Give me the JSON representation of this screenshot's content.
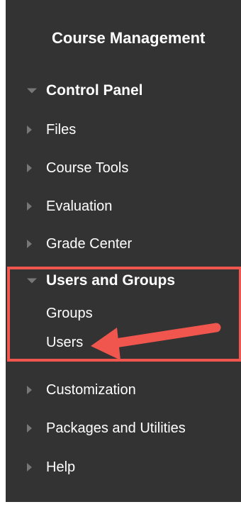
{
  "panel": {
    "title": "Course Management",
    "control_panel": "Control Panel",
    "items": [
      {
        "label": "Files"
      },
      {
        "label": "Course Tools"
      },
      {
        "label": "Evaluation"
      },
      {
        "label": "Grade Center"
      }
    ],
    "users_and_groups": {
      "label": "Users and Groups",
      "children": [
        {
          "label": "Groups"
        },
        {
          "label": "Users"
        }
      ]
    },
    "bottom_items": [
      {
        "label": "Customization"
      },
      {
        "label": "Packages and Utilities"
      },
      {
        "label": "Help"
      }
    ]
  },
  "colors": {
    "panel_bg": "#333333",
    "highlight": "#f0554e",
    "arrow": "#f0554e",
    "triangle": "#777777"
  }
}
